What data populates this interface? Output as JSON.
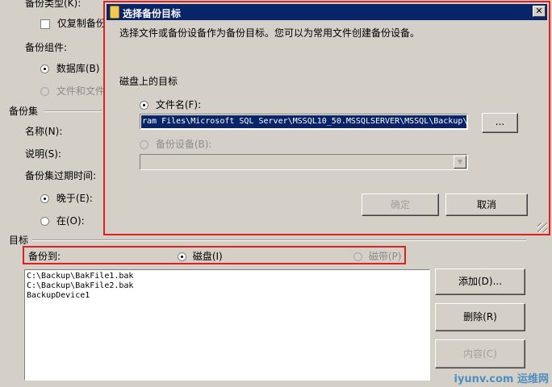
{
  "background_form": {
    "backup_type_label": "备份类型(K):",
    "copy_only_label": "仅复制备份",
    "backup_component_label": "备份组件:",
    "database_option": "数据库(B)",
    "files_option": "文件和文件",
    "backup_set_section": "备份集",
    "name_label": "名称(N):",
    "description_label": "说明(S):",
    "expire_label": "备份集过期时间:",
    "after_option": "晚于(E):",
    "on_option": "在(O):",
    "destination_section": "目标",
    "backup_to_label": "备份到:",
    "disk_option": "磁盘(I)",
    "tape_option": "磁带(P)",
    "destinations": [
      "C:\\Backup\\BakFile1.bak",
      "C:\\Backup\\BakFile2.bak",
      "BackupDevice1"
    ],
    "add_button": "添加(D)...",
    "remove_button": "删除(R)",
    "contents_button": "内容(C)"
  },
  "dialog": {
    "title": "选择备份目标",
    "close_glyph": "✕",
    "instruction": "选择文件或备份设备作为备份目标。您可以为常用文件创建备份设备。",
    "disk_destination_label": "磁盘上的目标",
    "file_name_option": "文件名(F):",
    "file_path_visible": "ram Files\\Microsoft SQL Server\\MSSQL10_50.MSSQLSERVER\\MSSQL\\Backup\\",
    "browse_button": "...",
    "backup_device_option": "备份设备(B):",
    "combo_arrow": "▼",
    "ok_button": "确定",
    "cancel_button": "取消"
  },
  "watermark": "iyunv.com 运维网",
  "colors": {
    "titlebar": "#0a246a",
    "highlight_box": "#e02020",
    "window_bg": "#d4d0c8"
  }
}
